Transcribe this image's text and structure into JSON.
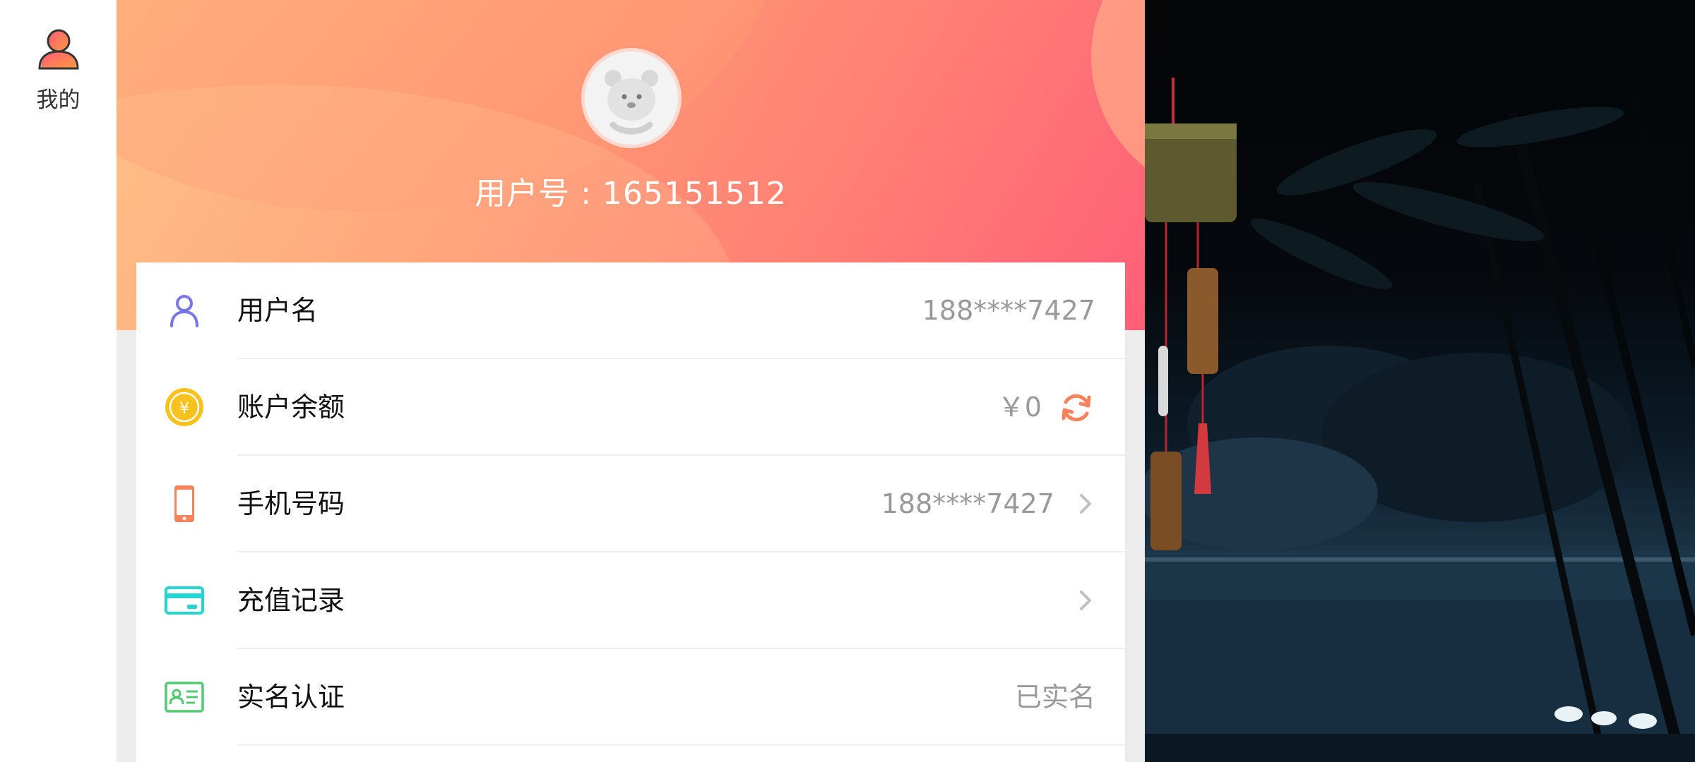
{
  "sidebar": {
    "tab_label": "我的",
    "tab_icon": "user-icon"
  },
  "header": {
    "user_id_text": "用户号 : 165151512",
    "avatar_icon": "bear-avatar-icon"
  },
  "rows": [
    {
      "label": "用户名",
      "value": "188****7427",
      "icon": "user-outline-icon",
      "icon_color": "#7b76e8"
    },
    {
      "label": "账户余额",
      "value": "￥0",
      "icon": "yen-coin-icon",
      "icon_color": "#f8c21e",
      "action_icon": "refresh-icon",
      "action_color": "#f7825b"
    },
    {
      "label": "手机号码",
      "value": "188****7427",
      "icon": "phone-icon",
      "icon_color": "#f7825b",
      "action_icon": "chevron-right-icon"
    },
    {
      "label": "充值记录",
      "value": "",
      "icon": "card-icon",
      "icon_color": "#25d5d0",
      "action_icon": "chevron-right-icon"
    },
    {
      "label": "实名认证",
      "value": "已实名",
      "icon": "id-card-icon",
      "icon_color": "#52c970"
    }
  ],
  "colors": {
    "header_start": "#ffc182",
    "header_end": "#ff5f78",
    "accent_orange": "#f7825b"
  }
}
